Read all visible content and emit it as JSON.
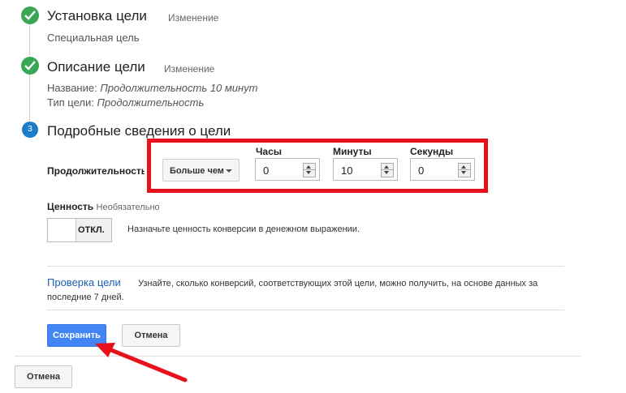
{
  "steps": [
    {
      "status": "done",
      "title": "Установка цели",
      "edit_label": "Изменение",
      "details": [
        {
          "label": "",
          "value": "Специальная цель"
        }
      ]
    },
    {
      "status": "done",
      "title": "Описание цели",
      "edit_label": "Изменение",
      "details": [
        {
          "label": "Название:",
          "value": "Продолжительность 10 минут"
        },
        {
          "label": "Тип цели:",
          "value": "Продолжительность"
        }
      ]
    },
    {
      "status": "current",
      "number": "3",
      "title": "Подробные сведения о цели"
    }
  ],
  "duration": {
    "label": "Продолжительность",
    "comparator": "Больше чем",
    "fields": [
      {
        "label": "Часы",
        "value": "0"
      },
      {
        "label": "Минуты",
        "value": "10"
      },
      {
        "label": "Секунды",
        "value": "0"
      }
    ]
  },
  "value_section": {
    "label": "Ценность",
    "optional": "Необязательно",
    "toggle_state": "ОТКЛ.",
    "description": "Назначьте ценность конверсии в денежном выражении."
  },
  "verify": {
    "link": "Проверка цели",
    "description_line1": "Узнайте, сколько конверсий, соответствующих этой цели, можно получить, на основе данных за",
    "description_line2": "последние 7 дней."
  },
  "buttons": {
    "save": "Сохранить",
    "cancel_inner": "Отмена",
    "cancel_outer": "Отмена"
  },
  "colors": {
    "check_green": "#3aa757",
    "step_blue": "#1f7cc7",
    "highlight_red": "#e8101a",
    "primary_button": "#4285f4",
    "link_blue": "#1a5fb4"
  },
  "icons": [
    "checkmark-icon",
    "dropdown-caret-icon",
    "spinner-arrows-icon",
    "annotation-arrow"
  ]
}
